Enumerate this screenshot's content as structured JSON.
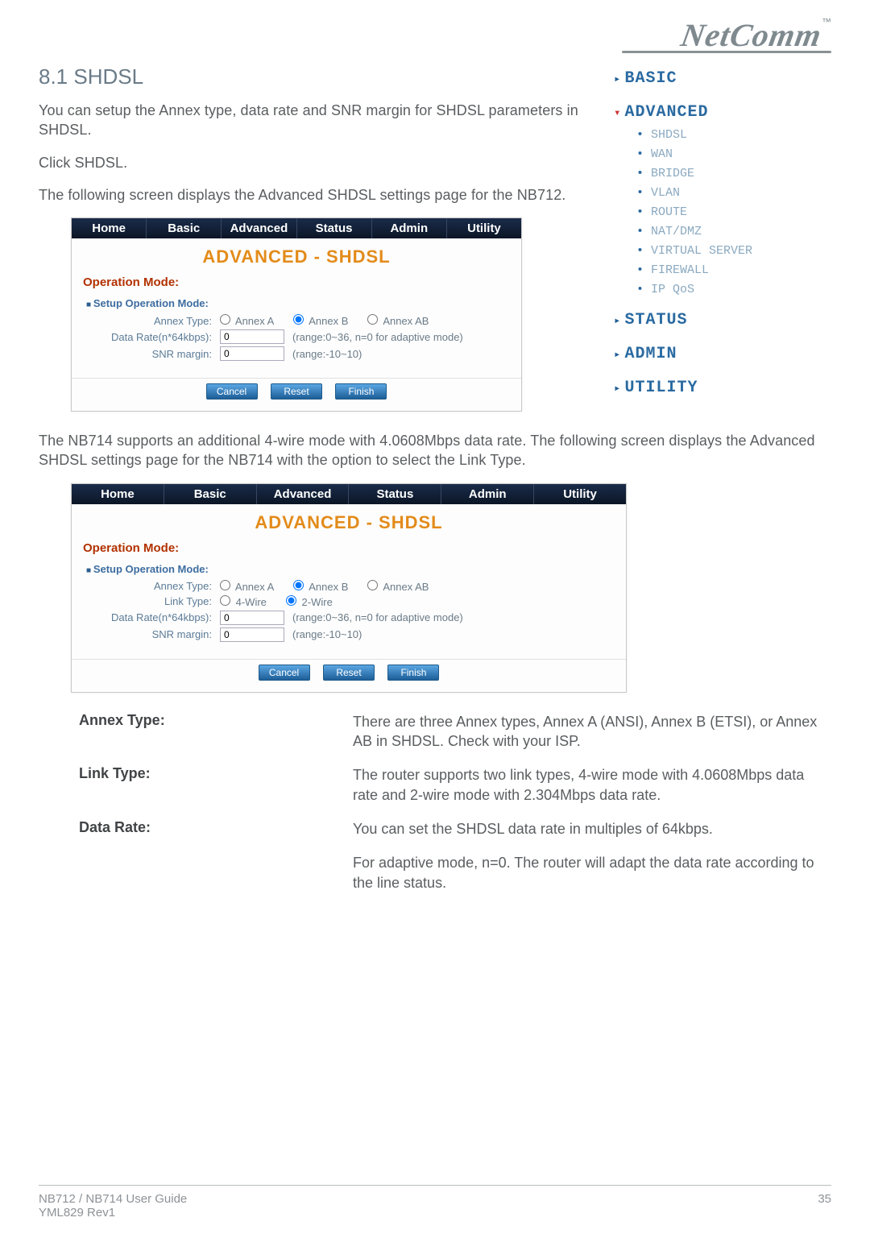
{
  "logo": {
    "text": "NetComm",
    "tm": "™"
  },
  "section": {
    "title": "8.1 SHDSL",
    "intro1": "You can setup the Annex type, data rate and SNR margin for SHDSL parameters in SHDSL.",
    "intro2": "Click SHDSL.",
    "intro3": "The following screen displays the Advanced SHDSL settings page for the NB712.",
    "intro4": "The NB714 supports an additional 4-wire mode with 4.0608Mbps data rate.  The following screen displays the Advanced SHDSL settings page for the NB714 with the option to select the Link Type."
  },
  "sidebar": {
    "basic": "BASIC",
    "advanced": "ADVANCED",
    "adv_items": [
      "SHDSL",
      "WAN",
      "BRIDGE",
      "VLAN",
      "ROUTE",
      "NAT/DMZ",
      "VIRTUAL SERVER",
      "FIREWALL",
      "IP QoS"
    ],
    "status": "STATUS",
    "admin": "ADMIN",
    "utility": "UTILITY"
  },
  "app": {
    "tabs": [
      "Home",
      "Basic",
      "Advanced",
      "Status",
      "Admin",
      "Utility"
    ],
    "title": "ADVANCED - SHDSL",
    "op_mode": "Operation Mode:",
    "setup_hdr": "Setup Operation Mode:",
    "annex_label": "Annex Type:",
    "annex_options": [
      "Annex A",
      "Annex B",
      "Annex AB"
    ],
    "annex_selected": "Annex B",
    "link_label": "Link Type:",
    "link_options": [
      "4-Wire",
      "2-Wire"
    ],
    "link_selected": "2-Wire",
    "rate_label": "Data Rate(n*64kbps):",
    "rate_value": "0",
    "rate_hint": "(range:0~36, n=0 for adaptive mode)",
    "snr_label": "SNR margin:",
    "snr_value": "0",
    "snr_hint": "(range:-10~10)",
    "buttons": [
      "Cancel",
      "Reset",
      "Finish"
    ]
  },
  "defs": {
    "rows": [
      {
        "label": "Annex Type:",
        "desc": "There are three Annex types, Annex A (ANSI), Annex B (ETSI), or Annex AB in SHDSL. Check with your ISP."
      },
      {
        "label": "Link Type:",
        "desc": "The router supports two link types, 4-wire mode with 4.0608Mbps data rate and 2-wire mode with 2.304Mbps data rate."
      },
      {
        "label": "Data Rate:",
        "desc": "You can set the SHDSL data rate in multiples of 64kbps."
      },
      {
        "label": "",
        "desc": "For adaptive mode, n=0. The router will adapt the data rate according to the line status."
      }
    ]
  },
  "footer": {
    "left1": "NB712 / NB714 User Guide",
    "left2": "YML829 Rev1",
    "right": "35"
  }
}
